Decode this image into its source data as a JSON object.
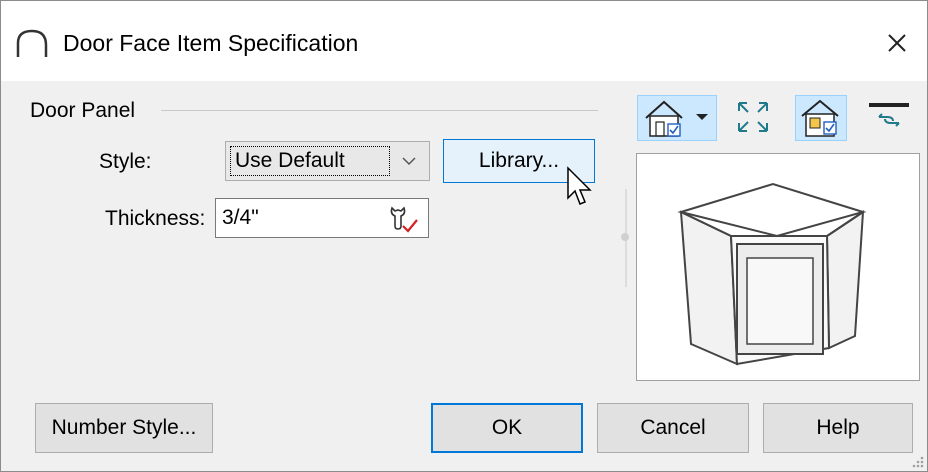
{
  "window": {
    "title": "Door Face Item Specification"
  },
  "door_panel": {
    "group_label": "Door Panel",
    "style_label": "Style:",
    "style_value": "Use Default",
    "library_button": "Library...",
    "thickness_label": "Thickness:",
    "thickness_value": "3/4\""
  },
  "footer": {
    "number_style": "Number Style...",
    "ok": "OK",
    "cancel": "Cancel",
    "help": "Help"
  },
  "icons": {
    "title": "arch-icon",
    "close": "close-icon",
    "toolbar": [
      "camera-view-dropdown-icon",
      "fit-view-icon",
      "view-settings-icon",
      "swap-icon"
    ]
  },
  "colors": {
    "accent": "#0078d7",
    "selected_tool_bg": "#cce8ff",
    "titlebar": "#ffffff"
  }
}
